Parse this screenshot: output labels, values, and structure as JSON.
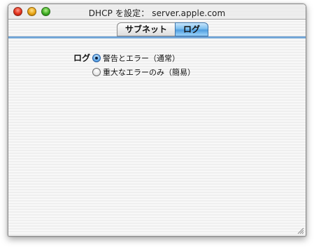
{
  "window": {
    "title": "DHCP を設定： server.apple.com"
  },
  "tabs": [
    {
      "label": "サブネット",
      "selected": false
    },
    {
      "label": "ログ",
      "selected": true
    }
  ],
  "log_settings": {
    "label": "ログ",
    "options": [
      {
        "label": "警告とエラー（通常）",
        "selected": true
      },
      {
        "label": "重大なエラーのみ（簡易）",
        "selected": false
      }
    ]
  }
}
